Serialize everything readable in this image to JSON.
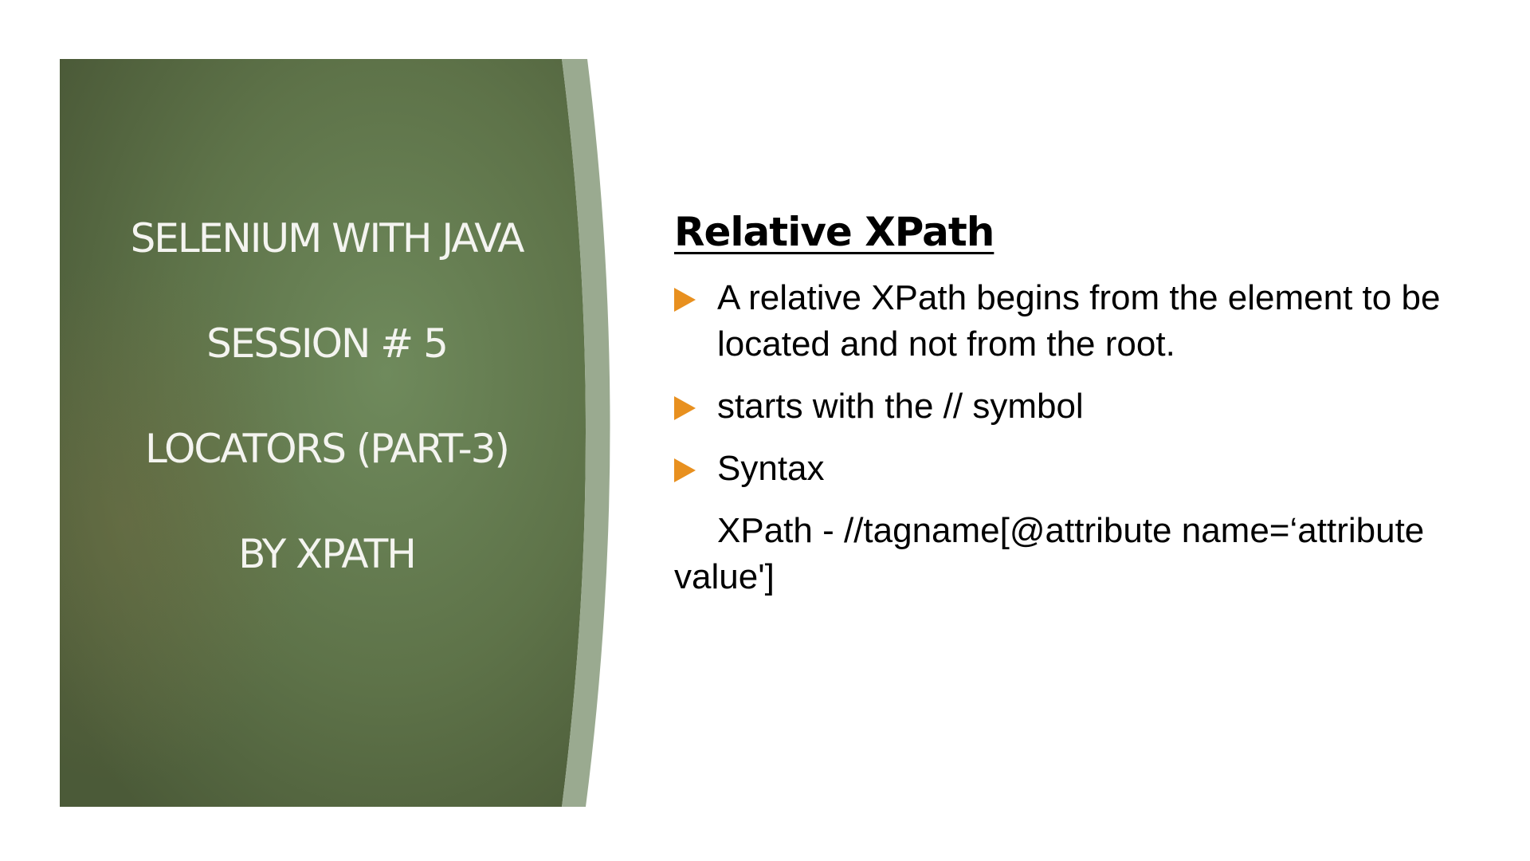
{
  "slide": {
    "title_panel": {
      "lines": [
        "SELENIUM WITH JAVA",
        "SESSION # 5",
        "LOCATORS (PART-3)",
        "BY XPATH"
      ],
      "colors": {
        "panel_dark": "#4f5f3d",
        "panel_light": "#6f8a5c",
        "panel_accent": "#8fa184",
        "text": "#f4f4f0"
      }
    },
    "content": {
      "heading": "Relative XPath",
      "bullets": [
        "A relative XPath begins from the element to be located and not from the root.",
        "starts with the // symbol",
        "Syntax"
      ],
      "syntax_text": "XPath - //tagname[@attribute name=‘attribute value']",
      "bullet_icon": "triangle-right-icon",
      "bullet_color": "#e8901f"
    }
  }
}
